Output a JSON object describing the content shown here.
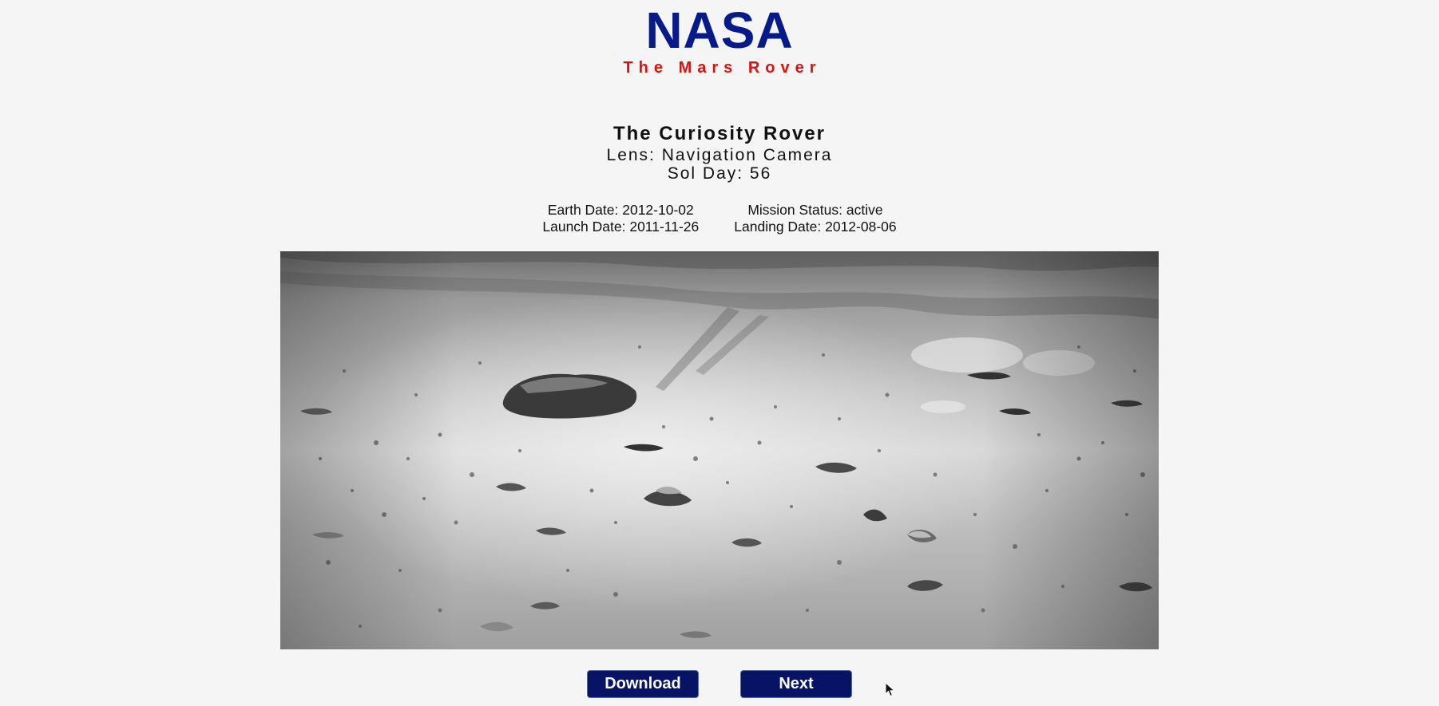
{
  "header": {
    "title": "NASA",
    "subtitle": "The Mars Rover"
  },
  "rover": {
    "name": "The Curiosity Rover",
    "lens": "Lens: Navigation Camera",
    "sol": "Sol Day: 56"
  },
  "meta": {
    "earth_date": "Earth Date: 2012-10-02",
    "launch_date": "Launch Date: 2011-11-26",
    "mission_status": "Mission Status: active",
    "landing_date": "Landing Date: 2012-08-06"
  },
  "buttons": {
    "download": "Download",
    "next": "Next"
  },
  "colors": {
    "title": "#071a8a",
    "subtitle": "#e01010",
    "button_bg": "#071466"
  },
  "icons": {
    "cursor": "mouse-pointer-icon"
  }
}
